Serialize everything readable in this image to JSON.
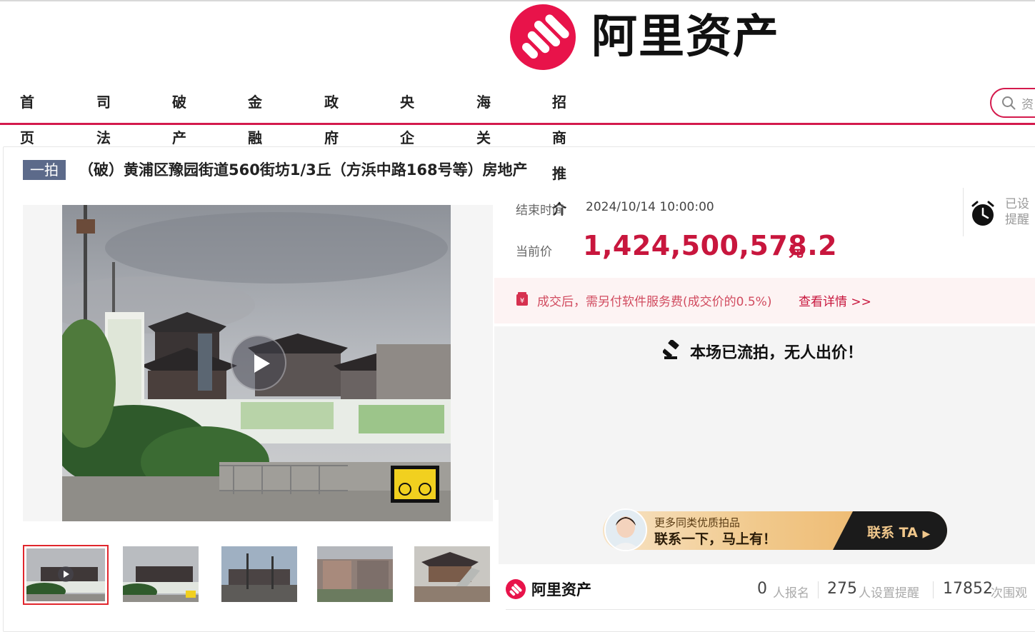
{
  "brand": {
    "name": "阿里资产",
    "color": "#e8134a"
  },
  "nav": {
    "items": [
      "首页",
      "司法",
      "破产",
      "金融",
      "政府",
      "央企",
      "海关",
      "招商推介"
    ],
    "search_placeholder": "资"
  },
  "listing": {
    "round_badge": "一拍",
    "title": "（破）黄浦区豫园街道560街坊1/3丘（方浜中路168号等）房地产"
  },
  "auction": {
    "end_time_label": "结束时间",
    "end_time": "2024/10/14 10:00:00",
    "price_label": "当前价",
    "price": "1,424,500,578.2",
    "price_unit": "元",
    "reminder_label": "已设提醒",
    "fee_notice": "成交后，需另付软件服务费(成交价的0.5%)",
    "fee_link": "查看详情 >>",
    "status": "本场已流拍，无人出价！"
  },
  "contact_banner": {
    "line1": "更多同类优质拍品",
    "line2": "联系一下，马上有！",
    "button": "联系 TA"
  },
  "stats": {
    "signups": "0",
    "signups_label": "人报名",
    "reminders": "275",
    "reminders_label": "人设置提醒",
    "views": "17852",
    "views_label": "次围观"
  },
  "gallery": {
    "thumbnail_count": 5,
    "active_index": 0
  }
}
